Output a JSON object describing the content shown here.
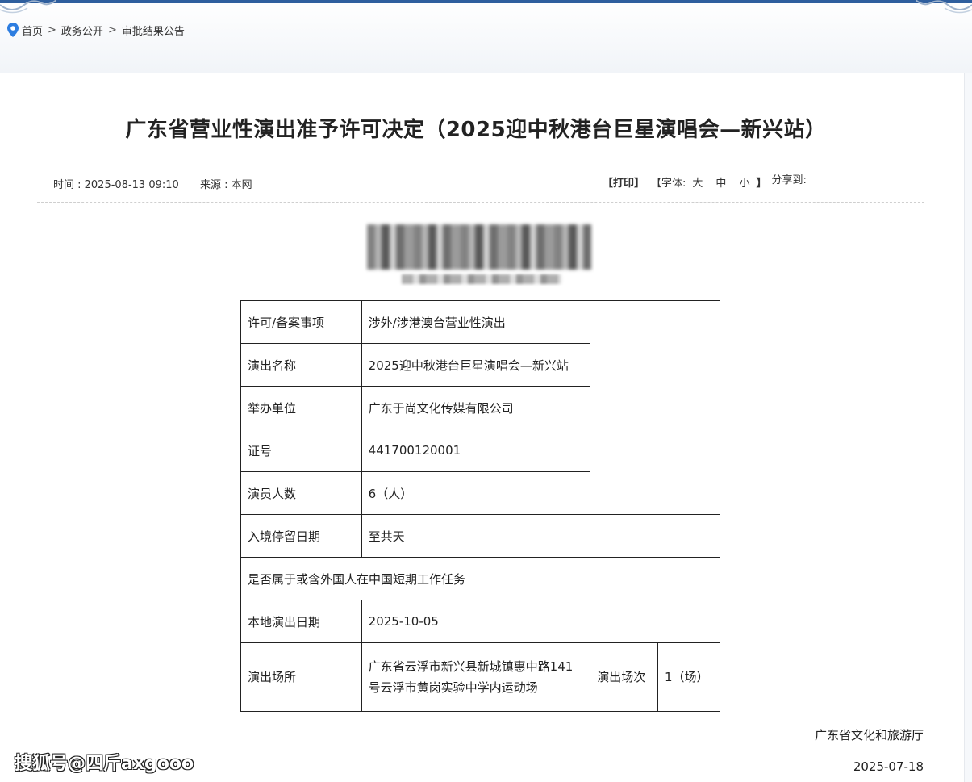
{
  "breadcrumb": {
    "items": [
      "首页",
      "政务公开",
      "审批结果公告"
    ],
    "separator": ">"
  },
  "article": {
    "title": "广东省营业性演出准予许可决定（2025迎中秋港台巨星演唱会—新兴站）",
    "time_label": "时间 : 2025-08-13 09:10",
    "source_label": "来源 : 本网",
    "tools": {
      "print": "【打印】",
      "font_prefix": "【字体:",
      "font_large": "大",
      "font_medium": "中",
      "font_small": "小",
      "font_suffix": "】",
      "share": "分享到:"
    }
  },
  "table": {
    "rows": [
      {
        "key": "许可/备案事项",
        "value": "涉外/涉港澳台营业性演出"
      },
      {
        "key": "演出名称",
        "value": "2025迎中秋港台巨星演唱会—新兴站"
      },
      {
        "key": "举办单位",
        "value": "广东于尚文化传媒有限公司"
      },
      {
        "key": "证号",
        "value": "441700120001"
      },
      {
        "key": "演员人数",
        "value": "6（人）"
      },
      {
        "key": "入境停留日期",
        "value": "至共天"
      },
      {
        "key": "是否属于或含外国人在中国短期工作任务",
        "value": ""
      },
      {
        "key": "本地演出日期",
        "value": "2025-10-05"
      },
      {
        "key": "演出场所",
        "value": "广东省云浮市新兴县新城镇惠中路141号云浮市黄岗实验中学内运动场",
        "extra_key": "演出场次",
        "extra_value": "1（场）"
      }
    ]
  },
  "footer": {
    "org": "广东省文化和旅游厅",
    "date": "2025-07-18"
  },
  "watermark": "搜狐号@四斤axgooo",
  "colors": {
    "top_line": "#2f5f9e",
    "pin": "#2d7de0",
    "background": "#f6f8fb"
  }
}
